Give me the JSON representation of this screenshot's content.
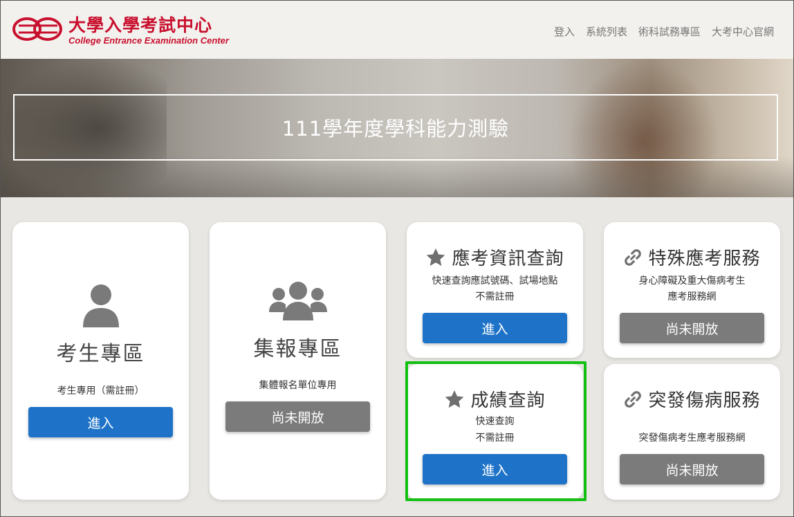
{
  "header": {
    "logo_cn": "大學入學考試中心",
    "logo_en": "College Entrance Examination Center",
    "nav": [
      "登入",
      "系統列表",
      "術科試務專區",
      "大考中心官網"
    ]
  },
  "banner": {
    "title": "111學年度學科能力測驗"
  },
  "cards": {
    "student": {
      "title": "考生專區",
      "subtitle": "考生專用（需註冊）",
      "button": "進入"
    },
    "group": {
      "title": "集報專區",
      "subtitle": "集體報名單位專用",
      "button": "尚未開放"
    },
    "exam_info": {
      "title": "應考資訊查詢",
      "line1": "快速查詢應試號碼、試場地點",
      "line2": "不需註冊",
      "button": "進入"
    },
    "special": {
      "title": "特殊應考服務",
      "line1": "身心障礙及重大傷病考生",
      "line2": "應考服務網",
      "button": "尚未開放"
    },
    "score": {
      "title": "成績查詢",
      "line1": "快速查詢",
      "line2": "不需註冊",
      "button": "進入"
    },
    "sudden": {
      "title": "突發傷病服務",
      "line1": "突發傷病考生應考服務網",
      "button": "尚未開放"
    }
  },
  "colors": {
    "brand_red": "#c8102e",
    "button_blue": "#1e73c8",
    "button_grey": "#7b7b7b",
    "highlight_green": "#12c012"
  }
}
